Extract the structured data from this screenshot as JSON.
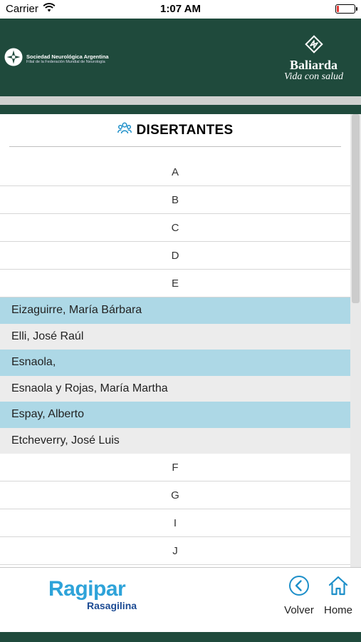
{
  "status_bar": {
    "carrier": "Carrier",
    "time": "1:07 AM"
  },
  "header": {
    "org_name": "Sociedad Neurológica Argentina",
    "org_subtitle": "Filial de la Federación Mundial de Neurología",
    "brand_name": "Baliarda",
    "brand_tagline": "Vida con salud"
  },
  "section": {
    "title": "DISERTANTES",
    "icon": "people-icon"
  },
  "list": {
    "letters_top": [
      "A",
      "B",
      "C",
      "D",
      "E"
    ],
    "names": [
      {
        "name": "Eizaguirre, María Bárbara",
        "tone": "blue"
      },
      {
        "name": "Elli, José Raúl",
        "tone": "gray"
      },
      {
        "name": "Esnaola,",
        "tone": "blue"
      },
      {
        "name": "Esnaola y Rojas, María Martha",
        "tone": "gray"
      },
      {
        "name": "Espay, Alberto",
        "tone": "blue"
      },
      {
        "name": "Etcheverry, José Luis",
        "tone": "gray"
      }
    ],
    "letters_bottom": [
      "F",
      "G",
      "I",
      "J"
    ]
  },
  "footer": {
    "product_name": "Ragipar",
    "product_subtitle": "Rasagilina",
    "back_label": "Volver",
    "home_label": "Home"
  },
  "colors": {
    "header_green": "#1f4a3c",
    "row_blue": "#add8e6",
    "row_gray": "#ececec",
    "nav_icon_blue": "#1d8fc9",
    "battery_red": "#e53935"
  }
}
